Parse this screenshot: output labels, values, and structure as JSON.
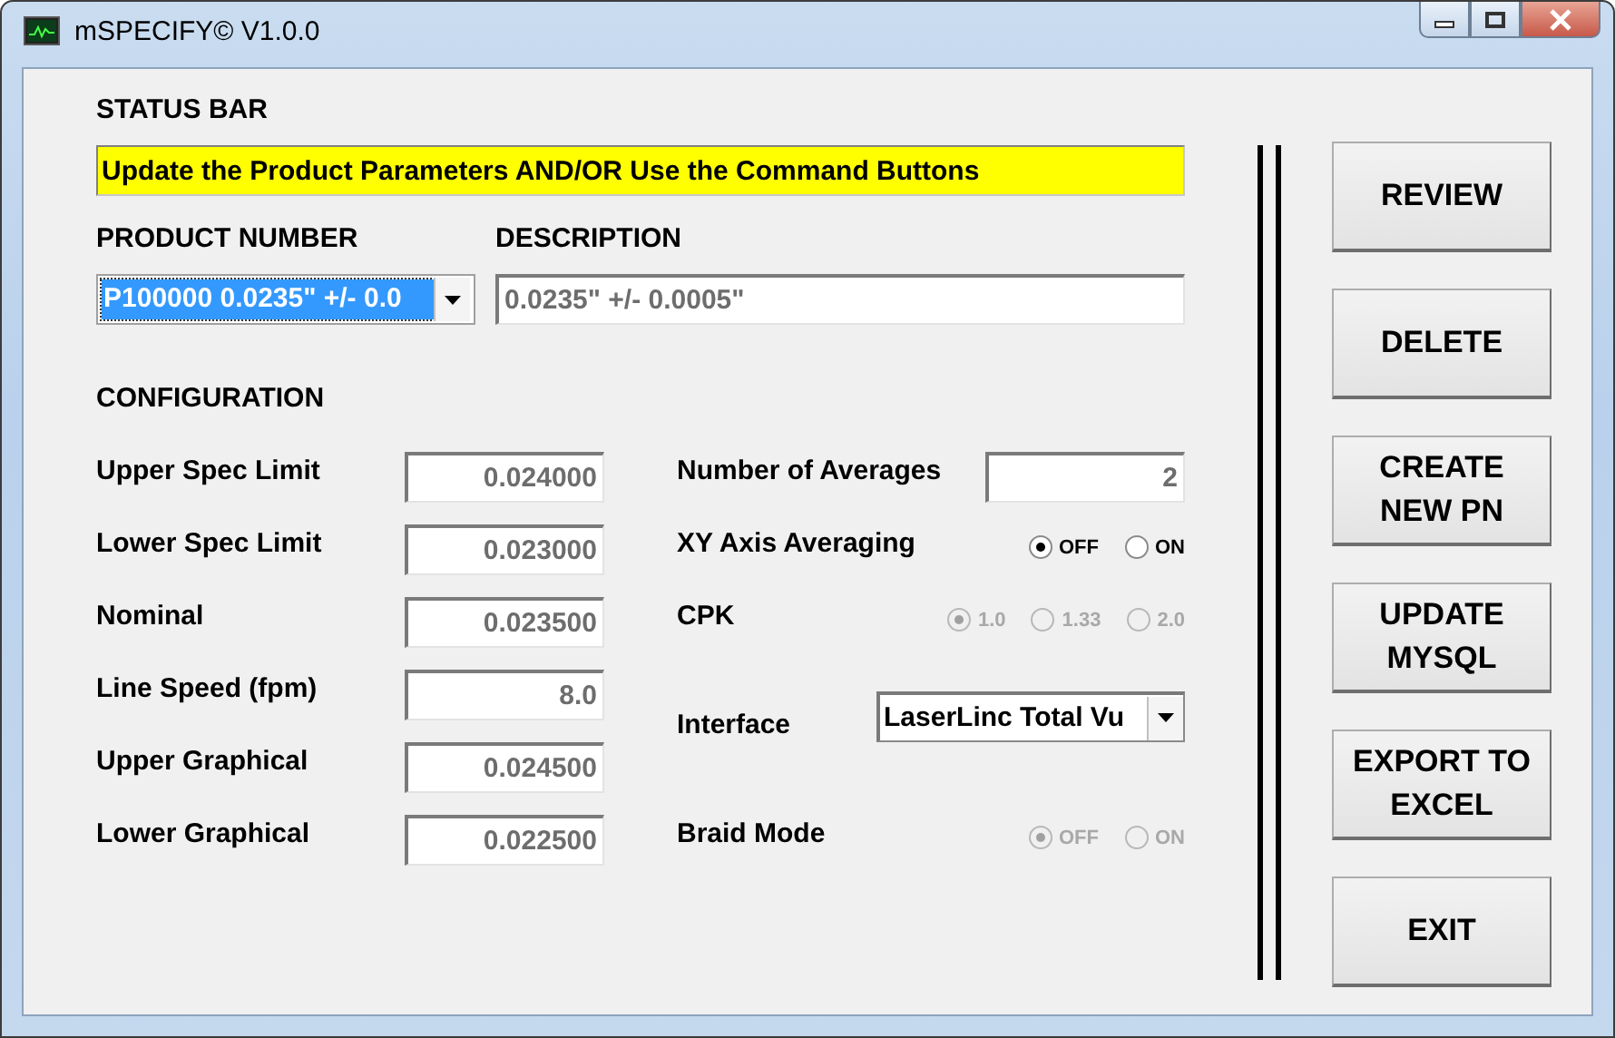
{
  "window": {
    "title": "mSPECIFY© V1.0.0"
  },
  "status": {
    "label": "STATUS BAR",
    "message": "Update the Product Parameters AND/OR Use the Command Buttons"
  },
  "product": {
    "label": "PRODUCT NUMBER",
    "value": "P100000 0.0235\" +/- 0.0"
  },
  "description": {
    "label": "DESCRIPTION",
    "value": "0.0235\" +/- 0.0005\""
  },
  "configuration": {
    "heading": "CONFIGURATION",
    "left": [
      {
        "label": "Upper Spec Limit",
        "value": "0.024000"
      },
      {
        "label": "Lower Spec Limit",
        "value": "0.023000"
      },
      {
        "label": "Nominal",
        "value": "0.023500"
      },
      {
        "label": "Line Speed (fpm)",
        "value": "8.0"
      },
      {
        "label": "Upper Graphical",
        "value": "0.024500"
      },
      {
        "label": "Lower Graphical",
        "value": "0.022500"
      }
    ],
    "right": [
      {
        "kind": "field",
        "label": "Number of Averages",
        "value": "2"
      },
      {
        "kind": "radio",
        "label": "XY Axis Averaging",
        "disabled": false,
        "options": [
          {
            "label": "OFF",
            "selected": true
          },
          {
            "label": "ON",
            "selected": false
          }
        ]
      },
      {
        "kind": "radio",
        "label": "CPK",
        "disabled": true,
        "options": [
          {
            "label": "1.0",
            "selected": true
          },
          {
            "label": "1.33",
            "selected": false
          },
          {
            "label": "2.0",
            "selected": false
          }
        ]
      },
      {
        "kind": "dropdown",
        "label": "Interface",
        "value": "LaserLinc Total Vu"
      },
      {
        "kind": "radio",
        "label": "Braid Mode",
        "disabled": true,
        "options": [
          {
            "label": "OFF",
            "selected": true
          },
          {
            "label": "ON",
            "selected": false
          }
        ]
      }
    ]
  },
  "buttons": [
    "REVIEW",
    "DELETE",
    "CREATE\nNEW PN",
    "UPDATE\nMYSQL",
    "EXPORT TO\nEXCEL",
    "EXIT"
  ]
}
